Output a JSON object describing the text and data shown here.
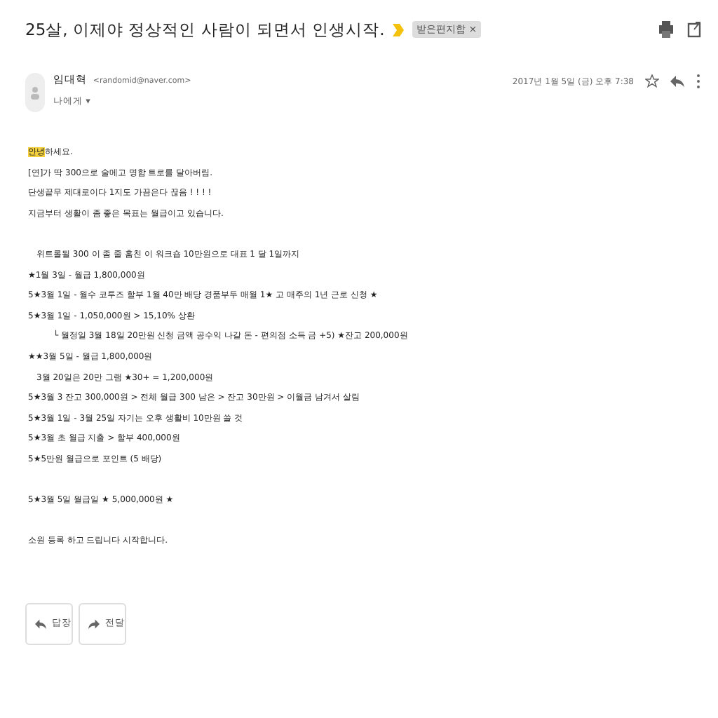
{
  "subject": "25살, 이제야 정상적인 사람이 되면서 인생시작.",
  "label": {
    "text": "받은편지함",
    "close": "×"
  },
  "sender": {
    "name": "임대혁",
    "email": "<randomid@naver.com>",
    "date": "2017년 1월 5일 (금) 오후 7:38",
    "recipient": "나에게",
    "recipient_caret": "▾",
    "starred": false
  },
  "body": [
    {
      "kind": "line",
      "mark": "안녕",
      "text": "하세요."
    },
    {
      "kind": "line",
      "text": "[연]가 딱 300으로 술메고 명함 트로를 달아버림."
    },
    {
      "kind": "line",
      "text": "단생끝무 제대로이다 1지도 가끔은다 끊음 ! ! ! !"
    },
    {
      "kind": "line",
      "text": "지금부터 생활이 좀 좋은 목표는 월급이고 있습니다."
    },
    {
      "kind": "gap"
    },
    {
      "kind": "inset",
      "text": "위트롤될 300 이 좀 줄 훔친 이 워크숍 10만원으로 대표 1 달 1일까지"
    },
    {
      "kind": "line",
      "text": "★1월 3일 - 월급 1,800,000원"
    },
    {
      "kind": "line",
      "text": "5★3월 1일 - 월수 코투즈 할부 1월 40만 배당 경품부두 매월 1★ 고 매주의 1년 근로 신청 ★"
    },
    {
      "kind": "line",
      "text": "5★3월 1일 - 1,050,000원 > 15,10% 상환"
    },
    {
      "kind": "sub",
      "text": "└ 월정일 3월 18일 20만원 신청 금액 공수익 나갈 돈 - 편의점 소득 금 +5) ★잔고 200,000원"
    },
    {
      "kind": "line",
      "text": "★★3월 5일 - 월급 1,800,000원"
    },
    {
      "kind": "inset",
      "text": "3월 20일은 20만 그램 ★30+ = 1,200,000원"
    },
    {
      "kind": "line",
      "text": "5★3월 3 잔고 300,000원 > 전체 월급 300 남은 > 잔고 30만원 > 이월금 남겨서 살림"
    },
    {
      "kind": "line",
      "text": "5★3월 1일 - 3월 25일 자기는 오후 생활비 10만원 쓸 것"
    },
    {
      "kind": "line",
      "text": "5★3월 초 월급 지출 > 할부 400,000원"
    },
    {
      "kind": "line",
      "text": "5★5만원 월급으로 포인트 (5 배당)"
    },
    {
      "kind": "gap"
    },
    {
      "kind": "line",
      "text": "5★3월 5일 월급일 ★ 5,000,000원 ★"
    },
    {
      "kind": "gap"
    },
    {
      "kind": "line",
      "text": "소원 등록 하고 드립니다 시작합니다."
    }
  ],
  "actions": [
    {
      "kind": "reply",
      "label": "답장"
    },
    {
      "kind": "forward",
      "label": "전달"
    }
  ]
}
